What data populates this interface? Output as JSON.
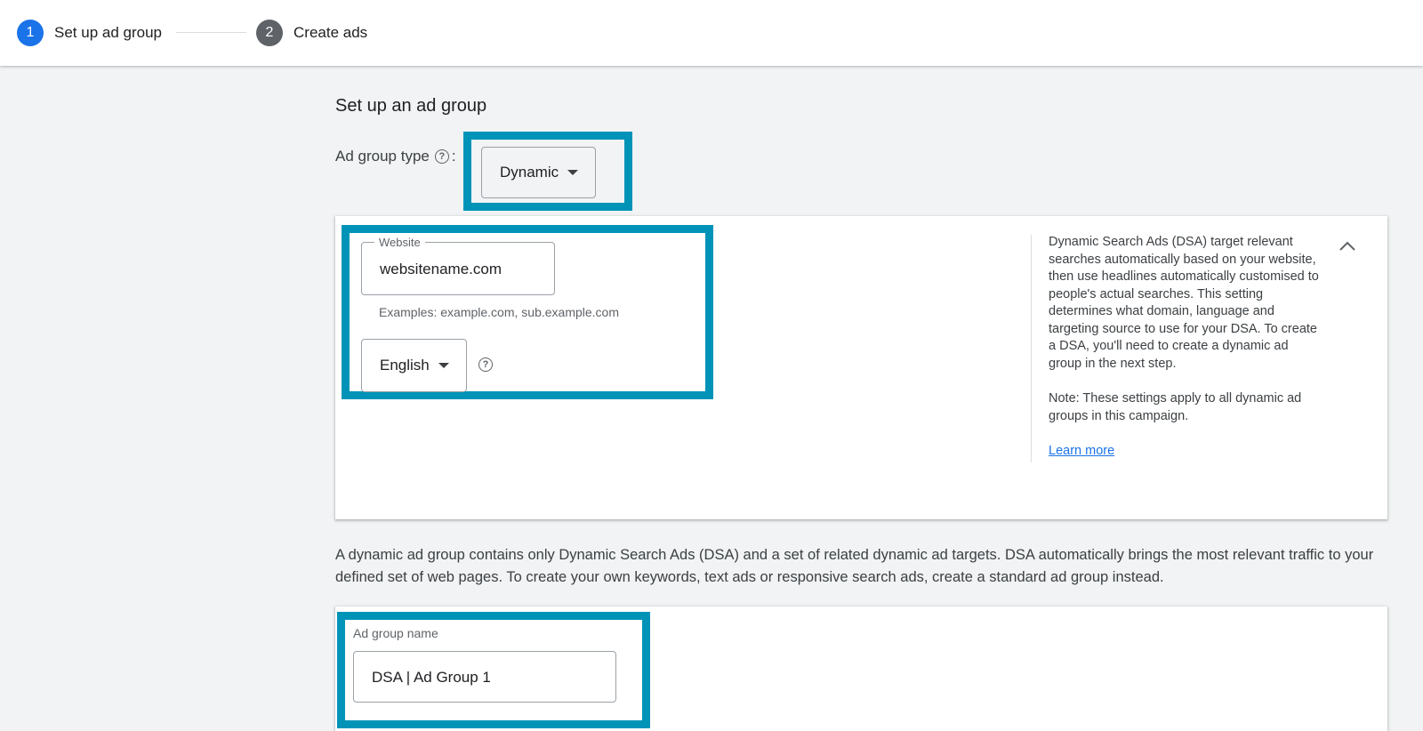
{
  "stepper": {
    "steps": [
      {
        "number": "1",
        "label": "Set up ad group",
        "state": "active"
      },
      {
        "number": "2",
        "label": "Create ads",
        "state": "inactive"
      }
    ]
  },
  "page": {
    "title": "Set up an ad group"
  },
  "ad_group_type": {
    "label": "Ad group type",
    "help_icon": "help-circle-icon",
    "colon": ":",
    "selected": "Dynamic"
  },
  "dsa_settings": {
    "website": {
      "legend": "Website",
      "value": "websitename.com",
      "hint": "Examples: example.com, sub.example.com"
    },
    "language": {
      "selected": "English",
      "help_icon": "help-circle-icon"
    },
    "info": {
      "text": "Dynamic Search Ads (DSA) target relevant searches automatically based on your website, then use headlines automatically customised to people's actual searches. This setting determines what domain, language and targeting source to use for your DSA. To create a DSA, you'll need to create a dynamic ad group in the next step.",
      "note": "Note: These settings apply to all dynamic ad groups in this campaign.",
      "link": "Learn more",
      "collapse_icon": "chevron-up-icon"
    }
  },
  "description": "A dynamic ad group contains only Dynamic Search Ads (DSA) and a set of related dynamic ad targets. DSA automatically brings the most relevant traffic to your defined set of web pages. To create your own keywords, text ads or responsive search ads, create a standard ad group instead.",
  "ad_group_name": {
    "label": "Ad group name",
    "value": "DSA | Ad Group 1"
  },
  "colors": {
    "accent": "#1a73e8",
    "highlight_border": "#0093b8",
    "background": "#f1f3f4"
  }
}
